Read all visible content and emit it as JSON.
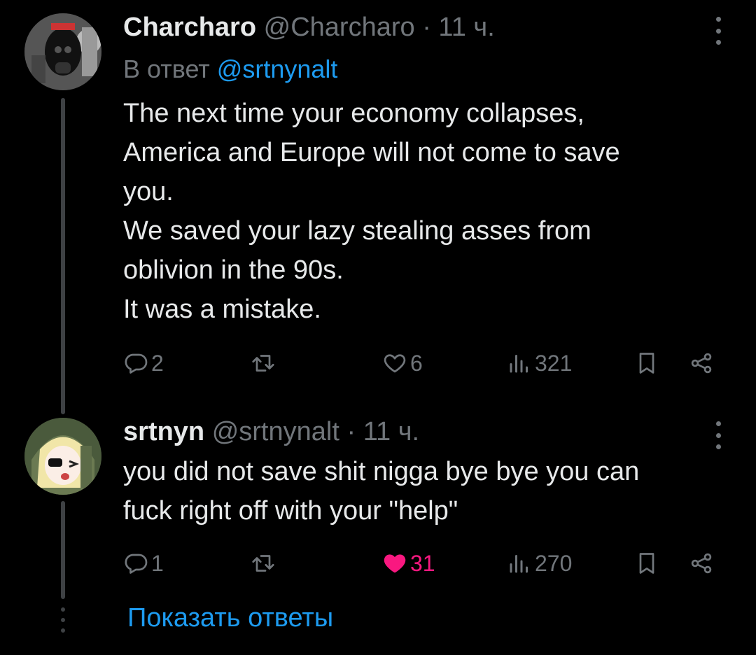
{
  "tweets": [
    {
      "name": "Charcharo",
      "handle": "@Charcharo",
      "separator": "·",
      "time": "11 ч.",
      "reply_prefix": "В ответ",
      "reply_mention": "@srtnynalt",
      "lines": [
        "The next time your economy collapses,",
        "America and Europe will not come to save",
        "you.",
        "We saved your lazy stealing asses from",
        "oblivion in the 90s.",
        "It was a mistake."
      ],
      "replies": "2",
      "likes": "6",
      "views": "321",
      "liked": false
    },
    {
      "name": "srtnyn",
      "handle": "@srtnynalt",
      "separator": "·",
      "time": "11 ч.",
      "lines": [
        "you did not save shit nigga bye bye you can",
        "fuck right off with your \"help\""
      ],
      "replies": "1",
      "likes": "31",
      "views": "270",
      "liked": true
    }
  ],
  "show_replies_label": "Показать ответы",
  "colors": {
    "background": "#000000",
    "text": "#e7e9ea",
    "muted": "#71767b",
    "link": "#1d9bf0",
    "like": "#f91880"
  },
  "icons": [
    "reply-icon",
    "retweet-icon",
    "like-icon",
    "views-icon",
    "bookmark-icon",
    "share-icon",
    "more-icon"
  ]
}
